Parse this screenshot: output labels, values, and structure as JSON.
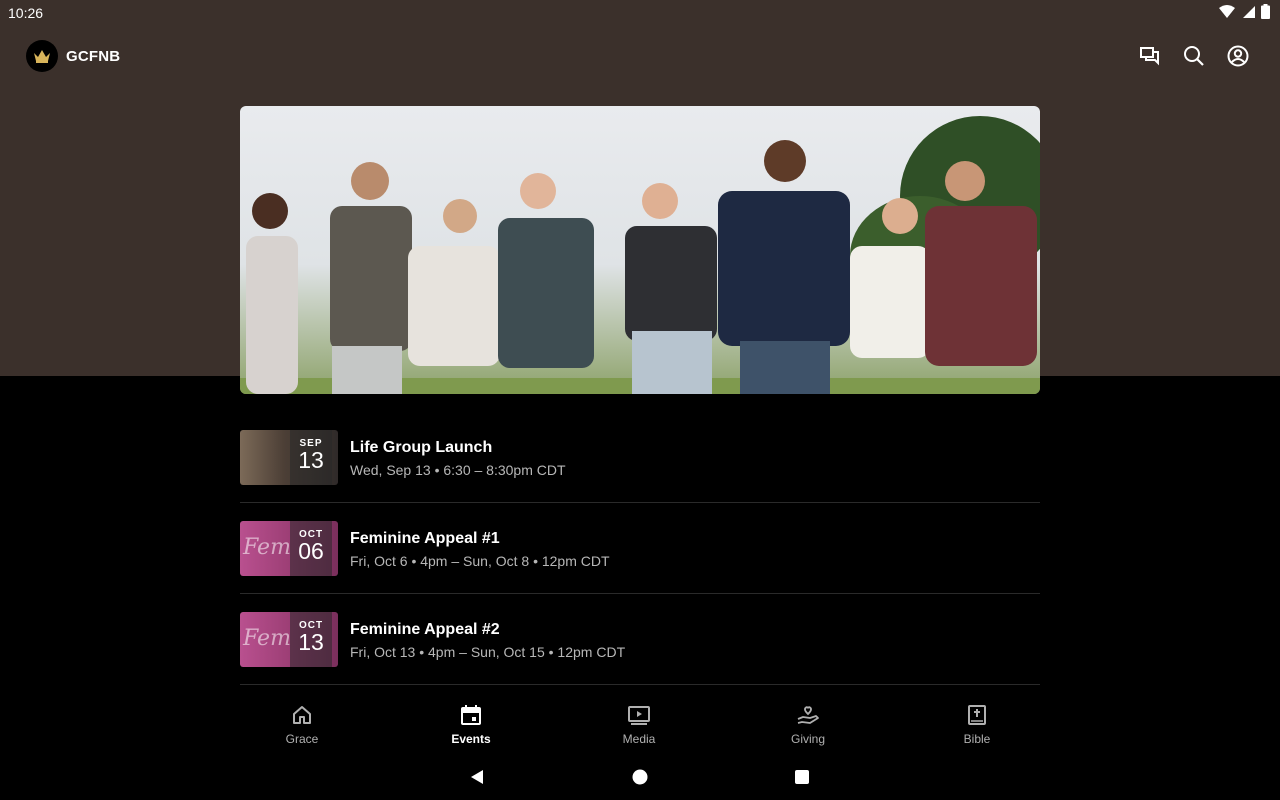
{
  "status_bar": {
    "time": "10:26"
  },
  "app": {
    "title": "GCFNB"
  },
  "colors": {
    "header_bg": "#3b302b",
    "background": "#000000",
    "thumb_pink": "#9a3d73"
  },
  "events": [
    {
      "title": "Life Group Launch",
      "subtitle": "Wed, Sep 13 • 6:30 – 8:30pm CDT",
      "month": "SEP",
      "day": "13",
      "thumb_text": ""
    },
    {
      "title": "Feminine Appeal #1",
      "subtitle": "Fri, Oct 6 • 4pm – Sun, Oct 8 • 12pm CDT",
      "month": "OCT",
      "day": "06",
      "thumb_text": "Fem"
    },
    {
      "title": "Feminine Appeal #2",
      "subtitle": "Fri, Oct 13 • 4pm – Sun, Oct 15 • 12pm CDT",
      "month": "OCT",
      "day": "13",
      "thumb_text": "Fem"
    }
  ],
  "nav": {
    "items": [
      {
        "label": "Grace",
        "icon": "home-icon"
      },
      {
        "label": "Events",
        "icon": "calendar-icon"
      },
      {
        "label": "Media",
        "icon": "media-icon"
      },
      {
        "label": "Giving",
        "icon": "giving-icon"
      },
      {
        "label": "Bible",
        "icon": "bible-icon"
      }
    ],
    "active": "Events"
  }
}
